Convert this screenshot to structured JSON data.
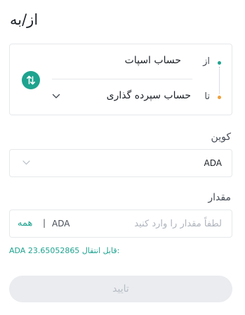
{
  "page": {
    "title": "از/به"
  },
  "transfer": {
    "from_label": "از",
    "to_label": "تا",
    "from_account": "حساب اسپات",
    "to_account": "حساب سپرده گذاری",
    "icons": {
      "swap": "swap-vertical-icon",
      "to_dropdown": "chevron-down-icon"
    },
    "colors": {
      "accent": "#1ea38f",
      "to_dot": "#f0a03b"
    }
  },
  "coin": {
    "label": "کوین",
    "selected": "ADA",
    "icon": "chevron-down-icon"
  },
  "amount": {
    "label": "مقدار",
    "placeholder": "لطفاً مقدار را وارد کنید",
    "coin": "ADA",
    "separator": "|",
    "all_button": "همه"
  },
  "available": {
    "label": "قابل انتقال:",
    "value": "23.65052865",
    "coin": "ADA"
  },
  "confirm": {
    "label": "تایید"
  }
}
